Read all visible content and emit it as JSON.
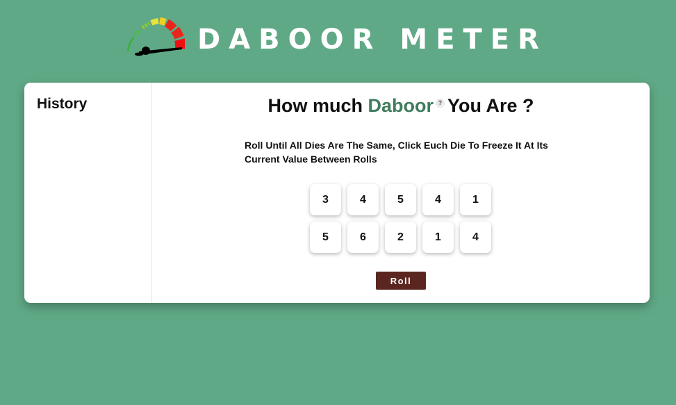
{
  "header": {
    "title": "DABOOR METER",
    "logo_icon": "speedometer-gauge-icon"
  },
  "sidebar": {
    "title": "History"
  },
  "main": {
    "headline_prefix": "How much ",
    "headline_brand": "Daboor",
    "help_badge": "?",
    "headline_suffix": "You Are ?",
    "instructions": "Roll Until All Dies Are The Same, Click Euch Die To Freeze It At Its Current Value Between Rolls",
    "dice": [
      {
        "value": "3"
      },
      {
        "value": "4"
      },
      {
        "value": "5"
      },
      {
        "value": "4"
      },
      {
        "value": "1"
      },
      {
        "value": "5"
      },
      {
        "value": "6"
      },
      {
        "value": "2"
      },
      {
        "value": "1"
      },
      {
        "value": "4"
      }
    ],
    "roll_label": "Roll"
  },
  "colors": {
    "background": "#60a986",
    "brand_text": "#3f7d5d",
    "roll_button": "#5c2620"
  }
}
